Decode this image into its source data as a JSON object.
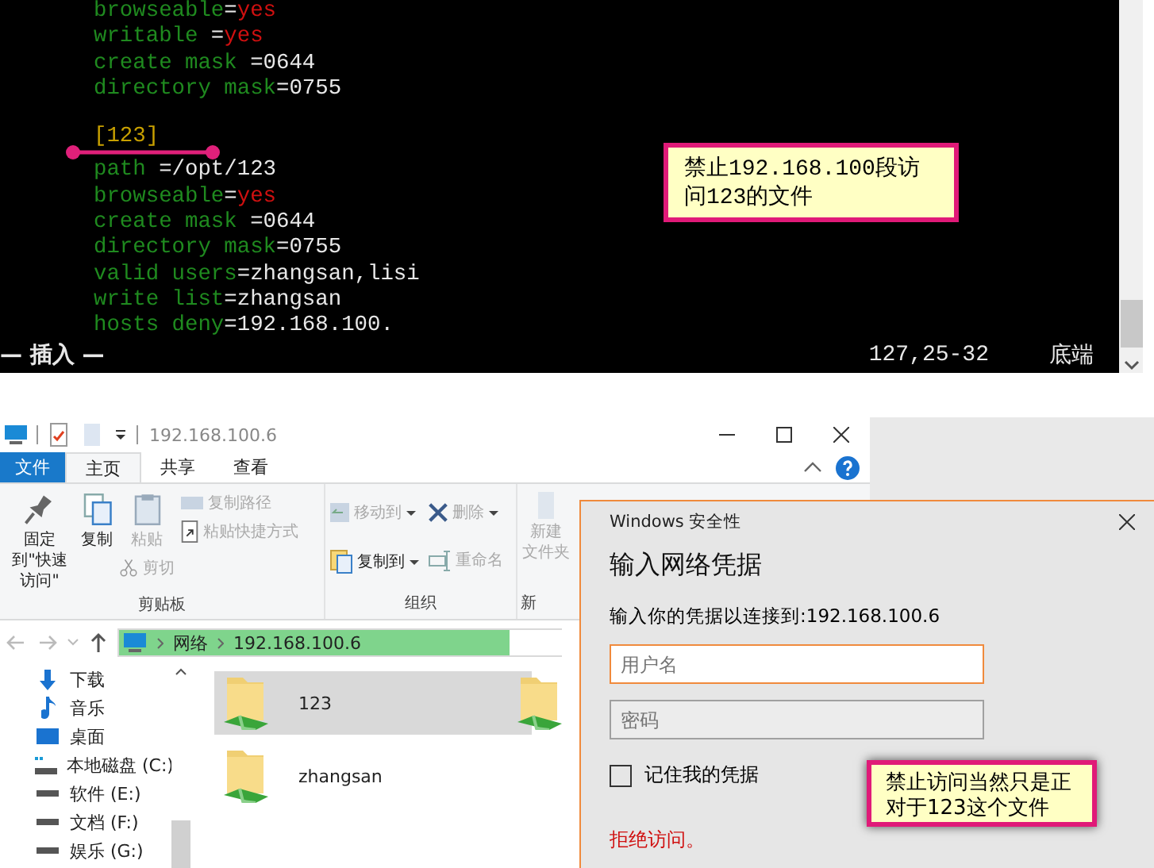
{
  "terminal": {
    "blocks": [
      {
        "lines": [
          [
            {
              "text": "browseable",
              "kind": "key"
            },
            {
              "text": "=",
              "kind": "value"
            },
            {
              "text": "yes",
              "kind": "flag"
            }
          ],
          [
            {
              "text": "writable",
              "kind": "key"
            },
            {
              "text": " =",
              "kind": "value"
            },
            {
              "text": "yes",
              "kind": "flag"
            }
          ],
          [
            {
              "text": "create mask",
              "kind": "key"
            },
            {
              "text": " =0644",
              "kind": "value"
            }
          ],
          [
            {
              "text": "directory mask",
              "kind": "key"
            },
            {
              "text": "=0755",
              "kind": "value"
            }
          ]
        ]
      },
      {
        "lines": [
          [
            {
              "text": "[123]",
              "kind": "section"
            }
          ],
          [
            {
              "text": "path",
              "kind": "key"
            },
            {
              "text": " =/opt/123",
              "kind": "value"
            }
          ],
          [
            {
              "text": "browseable",
              "kind": "key"
            },
            {
              "text": "=",
              "kind": "value"
            },
            {
              "text": "yes",
              "kind": "flag"
            }
          ],
          [
            {
              "text": "create mask",
              "kind": "key"
            },
            {
              "text": " =0644",
              "kind": "value"
            }
          ],
          [
            {
              "text": "directory mask",
              "kind": "key"
            },
            {
              "text": "=0755",
              "kind": "value"
            }
          ],
          [
            {
              "text": "valid users",
              "kind": "key"
            },
            {
              "text": "=zhangsan,lisi",
              "kind": "value"
            }
          ],
          [
            {
              "text": "write list",
              "kind": "key"
            },
            {
              "text": "=zhangsan",
              "kind": "value"
            }
          ],
          [
            {
              "text": "hosts deny",
              "kind": "key"
            },
            {
              "text": "=192.168.100.",
              "kind": "value"
            }
          ]
        ]
      }
    ],
    "mode": "— 插入 —",
    "position": "127,25-32",
    "scroll_position": "底端",
    "callout": {
      "lines": [
        "禁止192.168.100段访",
        "问123的文件"
      ]
    }
  },
  "explorer": {
    "title": "192.168.100.6",
    "tabs": [
      {
        "label": "文件",
        "kind": "file",
        "selected": false
      },
      {
        "label": "主页",
        "kind": "tab",
        "selected": true
      },
      {
        "label": "共享",
        "kind": "tab",
        "selected": false
      },
      {
        "label": "查看",
        "kind": "tab",
        "selected": false
      }
    ],
    "ribbon": {
      "clipboard": {
        "pin": {
          "label": "固定到\"快速访问\"",
          "disabled": false
        },
        "copy": {
          "label": "复制",
          "disabled": false
        },
        "paste": {
          "label": "粘贴",
          "disabled": true
        },
        "cut": {
          "label": "剪切",
          "disabled": true
        },
        "copy_path": {
          "label": "复制路径",
          "disabled": true
        },
        "paste_shortcut": {
          "label": "粘贴快捷方式",
          "disabled": true
        },
        "group_label": "剪贴板"
      },
      "organize": {
        "move_to": {
          "label": "移动到",
          "disabled": true
        },
        "copy_to": {
          "label": "复制到",
          "disabled": false
        },
        "delete": {
          "label": "删除",
          "disabled": true
        },
        "rename": {
          "label": "重命名",
          "disabled": true
        },
        "group_label": "组织"
      },
      "new": {
        "new_folder": {
          "lines": [
            "新建",
            "文件夹"
          ],
          "disabled": true
        },
        "group_label": "新"
      }
    },
    "breadcrumb": [
      "网络",
      "192.168.100.6"
    ],
    "nav_items": [
      {
        "label": "下载",
        "kind": "download"
      },
      {
        "label": "音乐",
        "kind": "music"
      },
      {
        "label": "桌面",
        "kind": "desktop"
      },
      {
        "label": "本地磁盘 (C:)",
        "kind": "system_drive"
      },
      {
        "label": "软件 (E:)",
        "kind": "drive"
      },
      {
        "label": "文档 (F:)",
        "kind": "drive"
      },
      {
        "label": "娱乐 (G:)",
        "kind": "drive"
      }
    ],
    "folders": [
      {
        "name": "123",
        "selected": true
      },
      {
        "name": "zhangsan",
        "selected": false
      }
    ]
  },
  "dialog": {
    "app": "Windows 安全性",
    "heading": "输入网络凭据",
    "message": "输入你的凭据以连接到:192.168.100.6",
    "username": {
      "placeholder": "用户名",
      "focused": true
    },
    "password": {
      "placeholder": "密码",
      "focused": false
    },
    "remember": {
      "label": "记住我的凭据",
      "checked": false
    },
    "error": "拒绝访问。",
    "callout": {
      "lines": [
        "禁止访问当然只是正",
        "对于123这个文件"
      ]
    }
  }
}
